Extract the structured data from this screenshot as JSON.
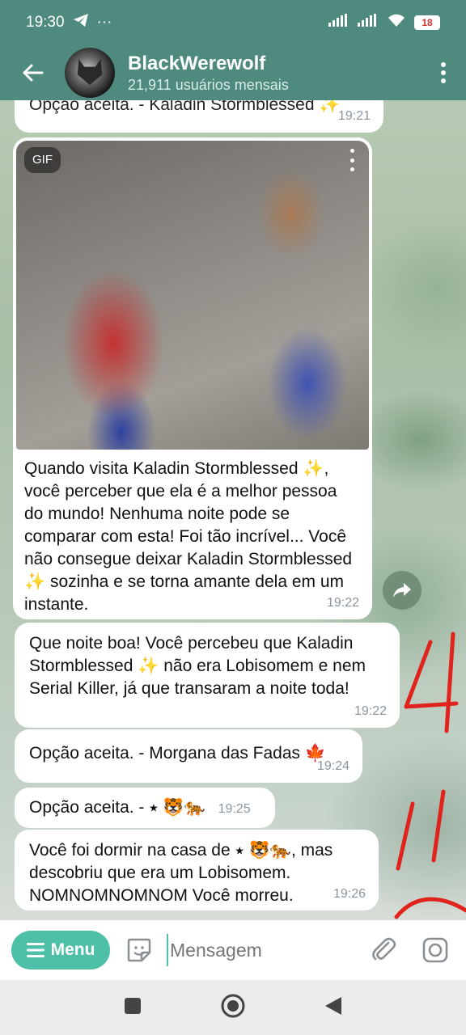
{
  "status_bar": {
    "time": "19:30",
    "dots": "···",
    "battery": "18"
  },
  "header": {
    "title": "BlackWerewolf",
    "subtitle": "21,911 usuários mensais"
  },
  "messages": [
    {
      "text": "Opção aceita. - Kaladin Stormblessed ✨",
      "time": "19:21"
    },
    {
      "gif_label": "GIF",
      "text": "Quando visita Kaladin Stormblessed ✨, você perceber que ela é a melhor pessoa do mundo! Nenhuma noite pode se comparar com esta! Foi tão incrível... Você não consegue deixar Kaladin Stormblessed ✨ sozinha e se torna amante dela em um instante.",
      "time": "19:22"
    },
    {
      "text": "Que noite boa! Você percebeu que Kaladin Stormblessed ✨ não era Lobisomem e nem Serial Killer, já que transaram a noite toda!",
      "time": "19:22"
    },
    {
      "text": "Opção aceita. - Morgana das Fadas 🍁",
      "time": "19:24"
    },
    {
      "text": "Opção aceita. - ⭑ 🐯🐅",
      "time": "19:25"
    },
    {
      "text": "Você foi dormir na casa de ⭑ 🐯🐅, mas descobriu que era um Lobisomem. NOMNOMNOMNOM Você morreu.",
      "time": "19:26"
    }
  ],
  "annotations": {
    "mark_1": "4",
    "mark_2": "11"
  },
  "input_bar": {
    "menu_label": "Menu",
    "placeholder": "Mensagem"
  },
  "colors": {
    "header": "#4f8a7e",
    "menu_button": "#4fc0a8",
    "annotation": "#e0231c"
  }
}
